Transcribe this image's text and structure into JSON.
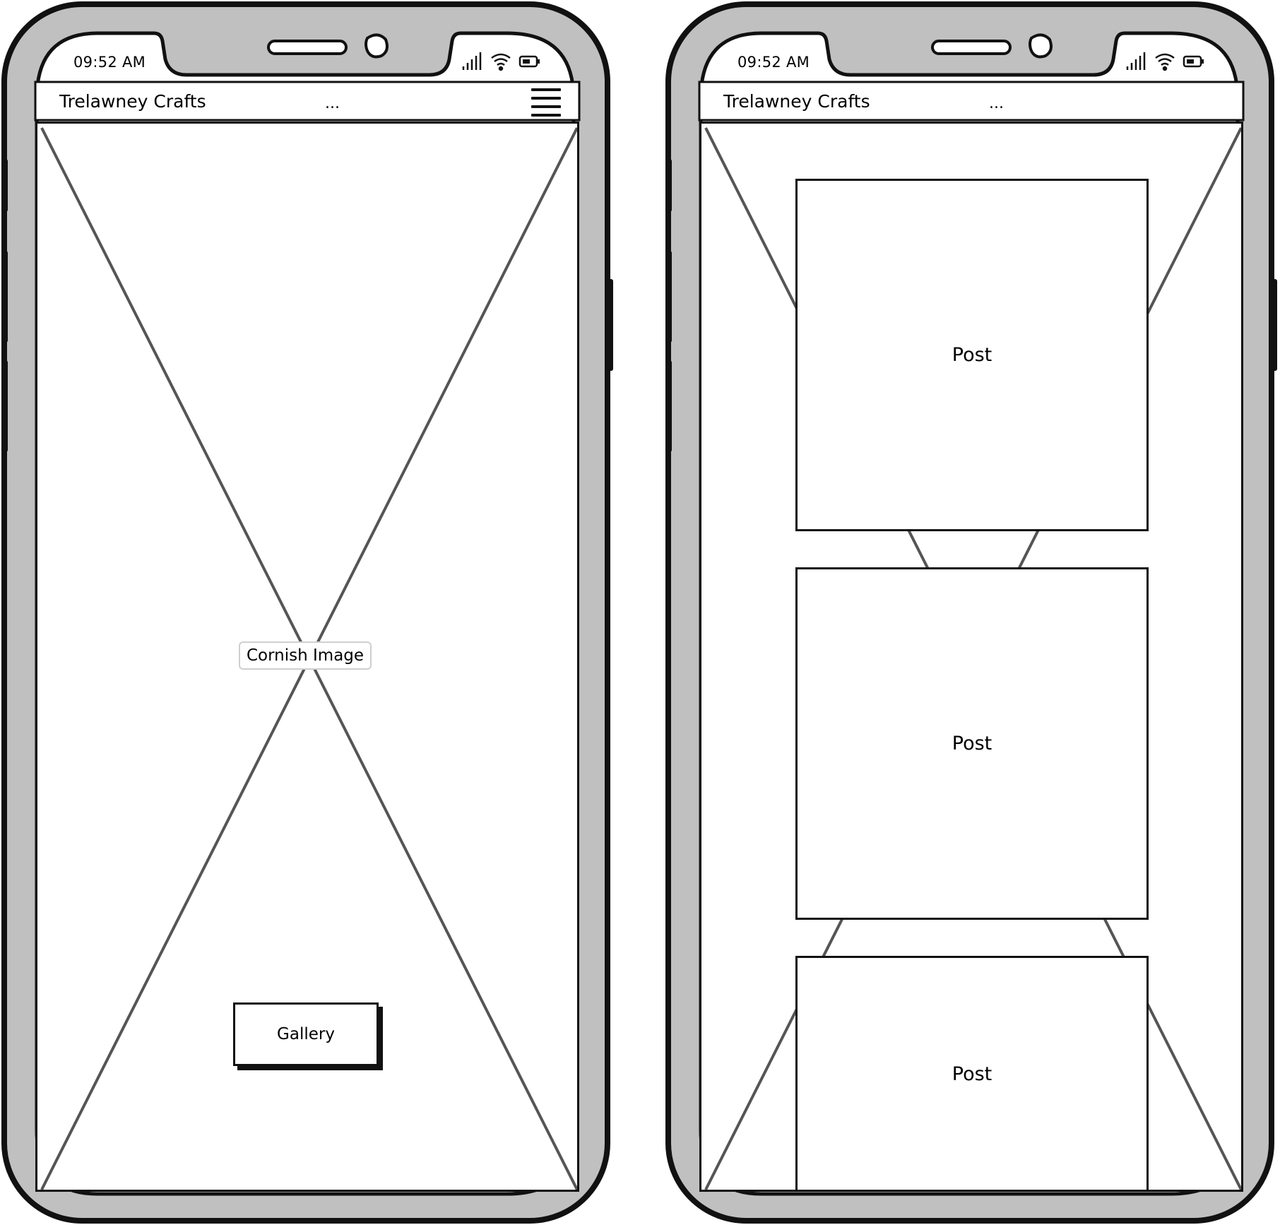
{
  "status_bar": {
    "time": "09:52 AM"
  },
  "app_bar": {
    "brand": "Trelawney Crafts",
    "menu_dots": "..."
  },
  "home_screen": {
    "hero_image_label": "Cornish Image",
    "gallery_button_label": "Gallery"
  },
  "gallery_screen": {
    "posts": [
      {
        "label": "Post"
      },
      {
        "label": "Post"
      },
      {
        "label": "Post"
      }
    ]
  },
  "colors": {
    "bezel": "#c0c0c0",
    "outline": "#111111",
    "placeholder_x": "#555555"
  },
  "icons": [
    "signal-icon",
    "wifi-icon",
    "battery-icon",
    "hamburger-menu-icon"
  ]
}
